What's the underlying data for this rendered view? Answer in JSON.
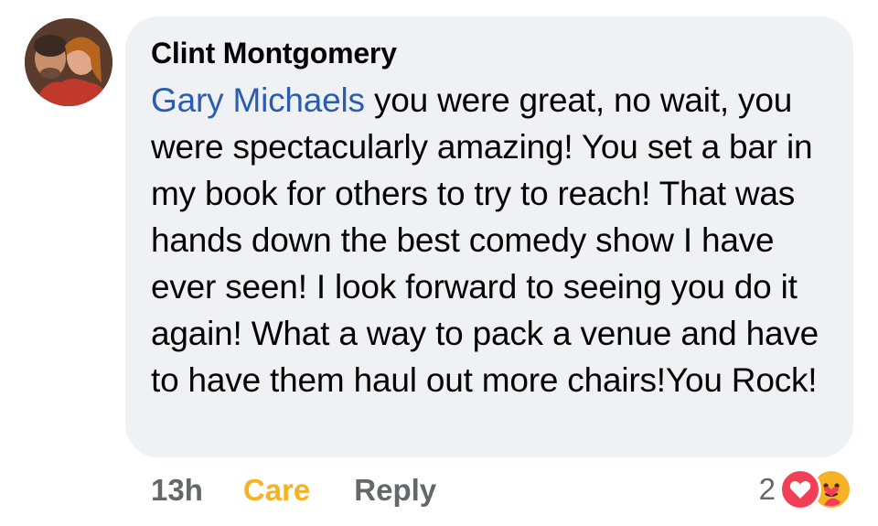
{
  "comment": {
    "author": "Clint Montgomery",
    "mention": "Gary Michaels",
    "text": " you were great, no wait, you were spectacularly amazing! You set a bar in my book for others to try to reach! That was hands down the best comedy show I have ever seen! I look forward to seeing you do it again! What a way to pack a venue and have to have them haul out more chairs!You Rock!",
    "avatar_icon": "profile-photo-avatar"
  },
  "actions": {
    "time": "13h",
    "care_label": "Care",
    "reply_label": "Reply"
  },
  "reactions": {
    "count": "2",
    "icons": [
      "love-icon",
      "care-icon"
    ],
    "colors": {
      "love": "#f33e58",
      "care": "#f7b125"
    }
  },
  "colors": {
    "bubble": "#eff1f5",
    "mention": "#2a5db0",
    "muted": "#65676b",
    "care": "#f7b125"
  }
}
